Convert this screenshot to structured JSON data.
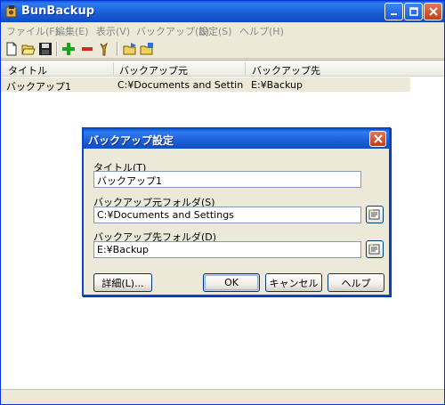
{
  "window": {
    "title": "BunBackup"
  },
  "menu": [
    {
      "label": "ファイル(F)"
    },
    {
      "label": "編集(E)"
    },
    {
      "label": "表示(V)"
    },
    {
      "label": "バックアップ(B)"
    },
    {
      "label": "設定(S)"
    },
    {
      "label": "ヘルプ(H)"
    }
  ],
  "toolbar": {
    "icons": [
      "new-file-icon",
      "open-folder-icon",
      "save-icon",
      "add-icon",
      "remove-icon",
      "properties-icon",
      "backup-run-icon",
      "backup-folder-icon"
    ]
  },
  "list": {
    "columns": [
      "タイトル",
      "バックアップ元",
      "バックアップ先"
    ],
    "rows": [
      [
        "バックアップ1",
        "C:¥Documents and Setting...",
        "E:¥Backup"
      ]
    ]
  },
  "dialog": {
    "title": "バックアップ設定",
    "title_label": "タイトル(T)",
    "title_value": "バックアップ1",
    "source_label": "バックアップ元フォルダ(S)",
    "source_value": "C:¥Documents and Settings",
    "dest_label": "バックアップ先フォルダ(D)",
    "dest_value": "E:¥Backup",
    "details_button": "詳細(L)...",
    "ok_button": "OK",
    "cancel_button": "キャンセル",
    "help_button": "ヘルプ"
  },
  "colors": {
    "titlebar": "#0a5bd7",
    "add": "#1aa41a",
    "remove": "#d8261c"
  }
}
